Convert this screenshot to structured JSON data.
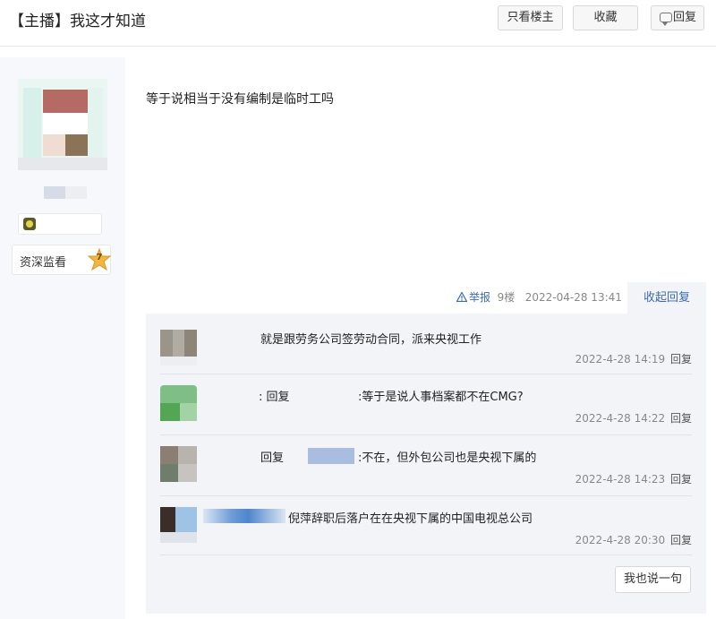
{
  "header": {
    "title": "【主播】我这才知道",
    "only_owner": "只看楼主",
    "favorite": "收藏",
    "reply": "回复"
  },
  "user": {
    "rank_label": "资深监看",
    "rank_level": "7"
  },
  "post": {
    "text": "等于说相当于没有编制是临时工吗",
    "report": "举报",
    "floor": "9楼",
    "date": "2022-04-28 13:41",
    "collapse": "收起回复"
  },
  "replies": [
    {
      "text": "就是跟劳务公司签劳动合同，派来央视工作",
      "time": "2022-4-28 14:19",
      "reply": "回复"
    },
    {
      "prefix": ": 回复",
      "text": ":等于是说人事档案都不在CMG?",
      "time": "2022-4-28 14:22",
      "reply": "回复"
    },
    {
      "prefix": "回复",
      "text": ":不在，但外包公司也是央视下属的",
      "time": "2022-4-28 14:23",
      "reply": "回复"
    },
    {
      "text": "倪萍辞职后落户在在央视下属的中国电视总公司",
      "time": "2022-4-28 20:30",
      "reply": "回复"
    }
  ],
  "say_button": "我也说一句",
  "colors": {
    "link": "#3a6ab5",
    "panel": "#f2f4f8",
    "sidebar": "#f7f8fb"
  },
  "icons": [
    "comment-icon",
    "warning-icon",
    "star-badge-icon",
    "level-badge-icon"
  ]
}
